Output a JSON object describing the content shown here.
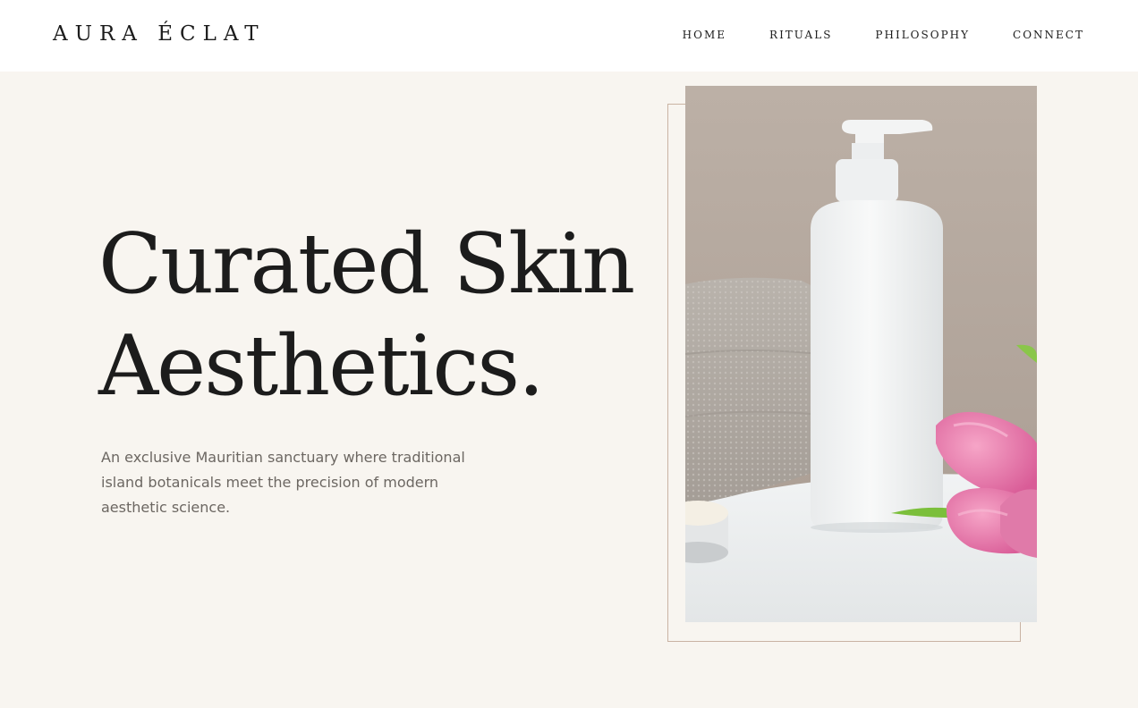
{
  "header": {
    "brand": "AURA ÉCLAT",
    "nav": [
      {
        "label": "HOME"
      },
      {
        "label": "RITUALS"
      },
      {
        "label": "PHILOSOPHY"
      },
      {
        "label": "CONNECT"
      }
    ]
  },
  "hero": {
    "title_line1": "Curated Skin",
    "title_line2": "Aesthetics.",
    "subtitle": "An exclusive Mauritian sanctuary where traditional island botanicals meet the precision of modern aesthetic science."
  },
  "colors": {
    "background": "#f8f5f0",
    "header_bg": "#ffffff",
    "text": "#1c1c1c",
    "muted_text": "#6c6762",
    "frame_border": "#c9b3a3"
  }
}
